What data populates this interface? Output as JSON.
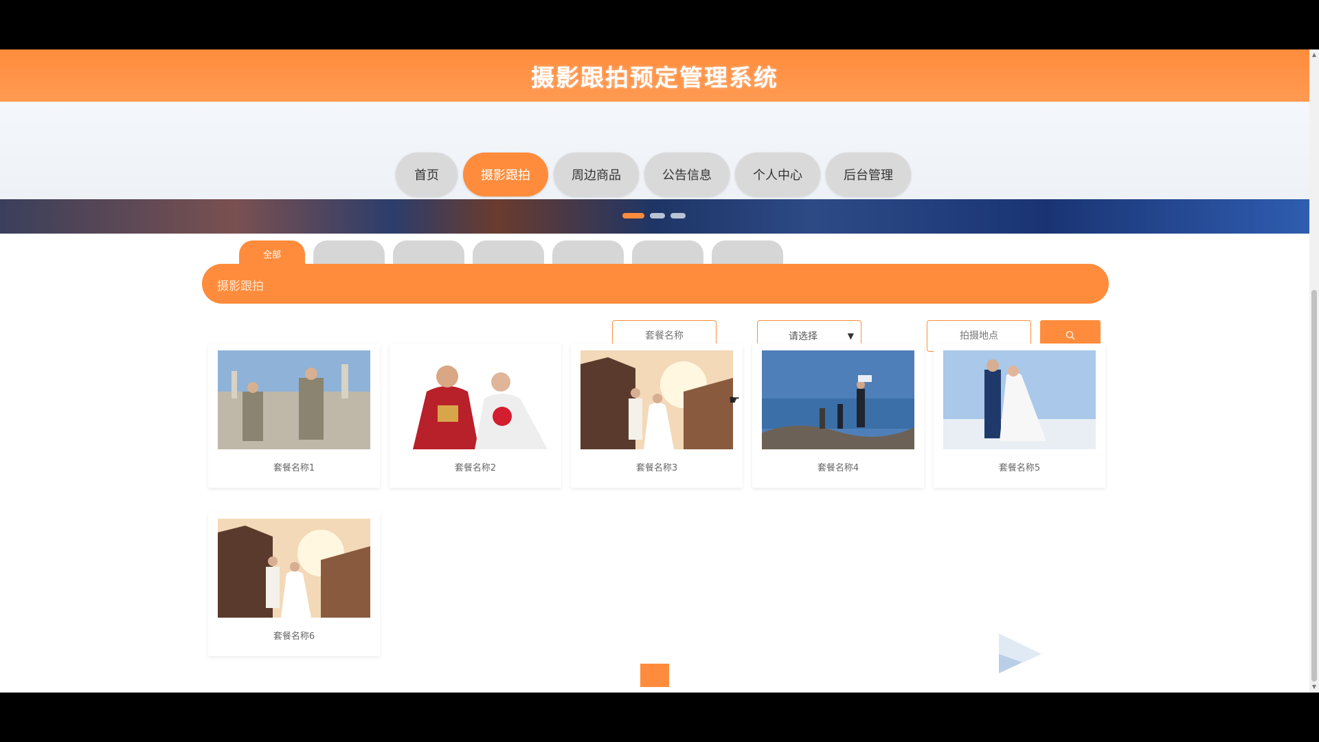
{
  "app": {
    "title": "摄影跟拍预定管理系统"
  },
  "nav": {
    "items": [
      {
        "label": "首页",
        "active": false,
        "wide": false
      },
      {
        "label": "摄影跟拍",
        "active": true,
        "wide": true
      },
      {
        "label": "周边商品",
        "active": false,
        "wide": true
      },
      {
        "label": "公告信息",
        "active": false,
        "wide": true
      },
      {
        "label": "个人中心",
        "active": false,
        "wide": true
      },
      {
        "label": "后台管理",
        "active": false,
        "wide": true
      }
    ]
  },
  "banner": {
    "slides": 3,
    "active_slide": 1
  },
  "subtabs": [
    {
      "label": "全部",
      "active": true
    },
    {
      "label": "",
      "active": false
    },
    {
      "label": "",
      "active": false
    },
    {
      "label": "",
      "active": false
    },
    {
      "label": "",
      "active": false
    },
    {
      "label": "",
      "active": false
    },
    {
      "label": "",
      "active": false
    }
  ],
  "section": {
    "title": "摄影跟拍"
  },
  "filters": {
    "name_placeholder": "套餐名称",
    "type_select_value": "请选择",
    "location_placeholder": "拍摄地点"
  },
  "cards": [
    {
      "name": "套餐名称1",
      "image": "two-grooms-in-uniform-on-steps"
    },
    {
      "name": "套餐名称2",
      "image": "couple-in-red-traditional-wedding-clothes"
    },
    {
      "name": "套餐名称3",
      "image": "couple-at-sunset-by-pagoda"
    },
    {
      "name": "套餐名称4",
      "image": "couple-on-rocks-by-sea"
    },
    {
      "name": "套餐名称5",
      "image": "couple-kissing-under-blue-sky"
    },
    {
      "name": "套餐名称6",
      "image": "couple-at-sunset-by-pagoda"
    }
  ],
  "colors": {
    "accent": "#ff8c3c",
    "nav_inactive": "#d9d9d9"
  }
}
